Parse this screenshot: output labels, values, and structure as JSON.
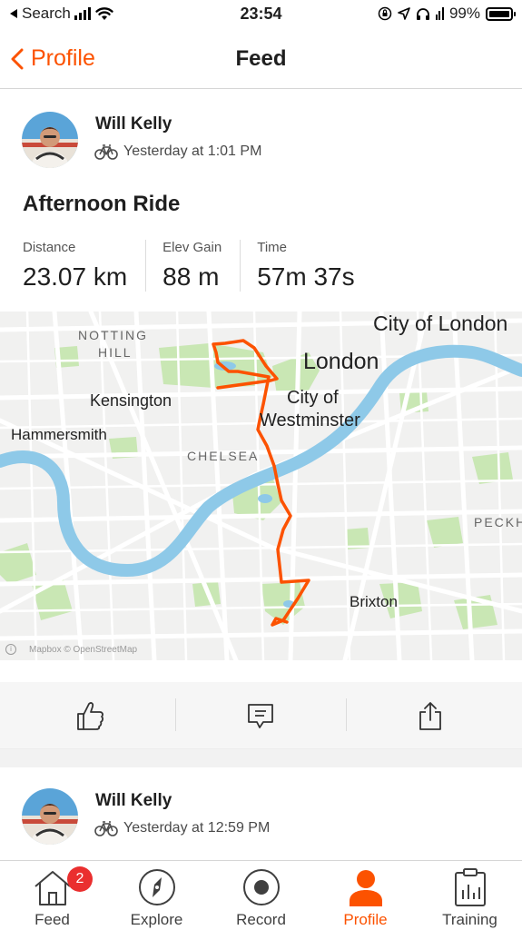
{
  "status_bar": {
    "back_app": "Search",
    "time": "23:54",
    "battery": "99%",
    "battery_level": 0.99
  },
  "header": {
    "back_label": "Profile",
    "title": "Feed"
  },
  "activity": {
    "athlete": "Will Kelly",
    "timestamp": "Yesterday at 1:01 PM",
    "title": "Afternoon Ride",
    "stats": [
      {
        "label": "Distance",
        "value": "23.07 km"
      },
      {
        "label": "Elev Gain",
        "value": "88 m"
      },
      {
        "label": "Time",
        "value": "57m 37s"
      }
    ],
    "map": {
      "labels": {
        "notting_hill_1": "NOTTING",
        "notting_hill_2": "HILL",
        "city_of_london": "City of London",
        "london": "London",
        "kensington": "Kensington",
        "city_of": "City of",
        "westminster": "Westminster",
        "hammersmith": "Hammersmith",
        "chelsea": "CHELSEA",
        "peckham": "PECKH",
        "brixton": "Brixton"
      },
      "attribution": "Mapbox © OpenStreetMap"
    }
  },
  "next_activity": {
    "athlete": "Will Kelly",
    "timestamp": "Yesterday at 12:59 PM"
  },
  "tabs": [
    {
      "label": "Feed",
      "icon": "home-icon",
      "badge": "2"
    },
    {
      "label": "Explore",
      "icon": "compass-icon"
    },
    {
      "label": "Record",
      "icon": "record-icon"
    },
    {
      "label": "Profile",
      "icon": "person-icon",
      "active": true
    },
    {
      "label": "Training",
      "icon": "clipboard-chart-icon"
    }
  ],
  "colors": {
    "brand": "#fc5200",
    "route": "#fc5200",
    "water": "#8ec9e8",
    "park": "#c9e7b4",
    "badge": "#ea2f2f"
  }
}
